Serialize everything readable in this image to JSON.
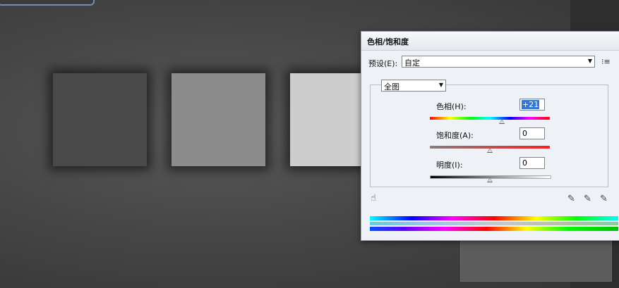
{
  "dialog": {
    "title": "色相/饱和度",
    "preset_label": "预设(E):",
    "preset_value": "自定",
    "channel_value": "全图",
    "hue": {
      "label": "色相(H):",
      "value": "+21",
      "position": 0.6
    },
    "saturation": {
      "label": "饱和度(A):",
      "value": "0",
      "position": 0.5
    },
    "lightness": {
      "label": "明度(I):",
      "value": "0",
      "position": 0.5
    }
  },
  "canvas": {
    "swatch_colors": [
      "#4a4a4a",
      "#8c8c8c",
      "#cdcdcd"
    ]
  },
  "icons": [
    "menu-icon",
    "hand-icon",
    "eyedropper-icon",
    "eyedropper-plus-icon",
    "eyedropper-minus-icon"
  ]
}
